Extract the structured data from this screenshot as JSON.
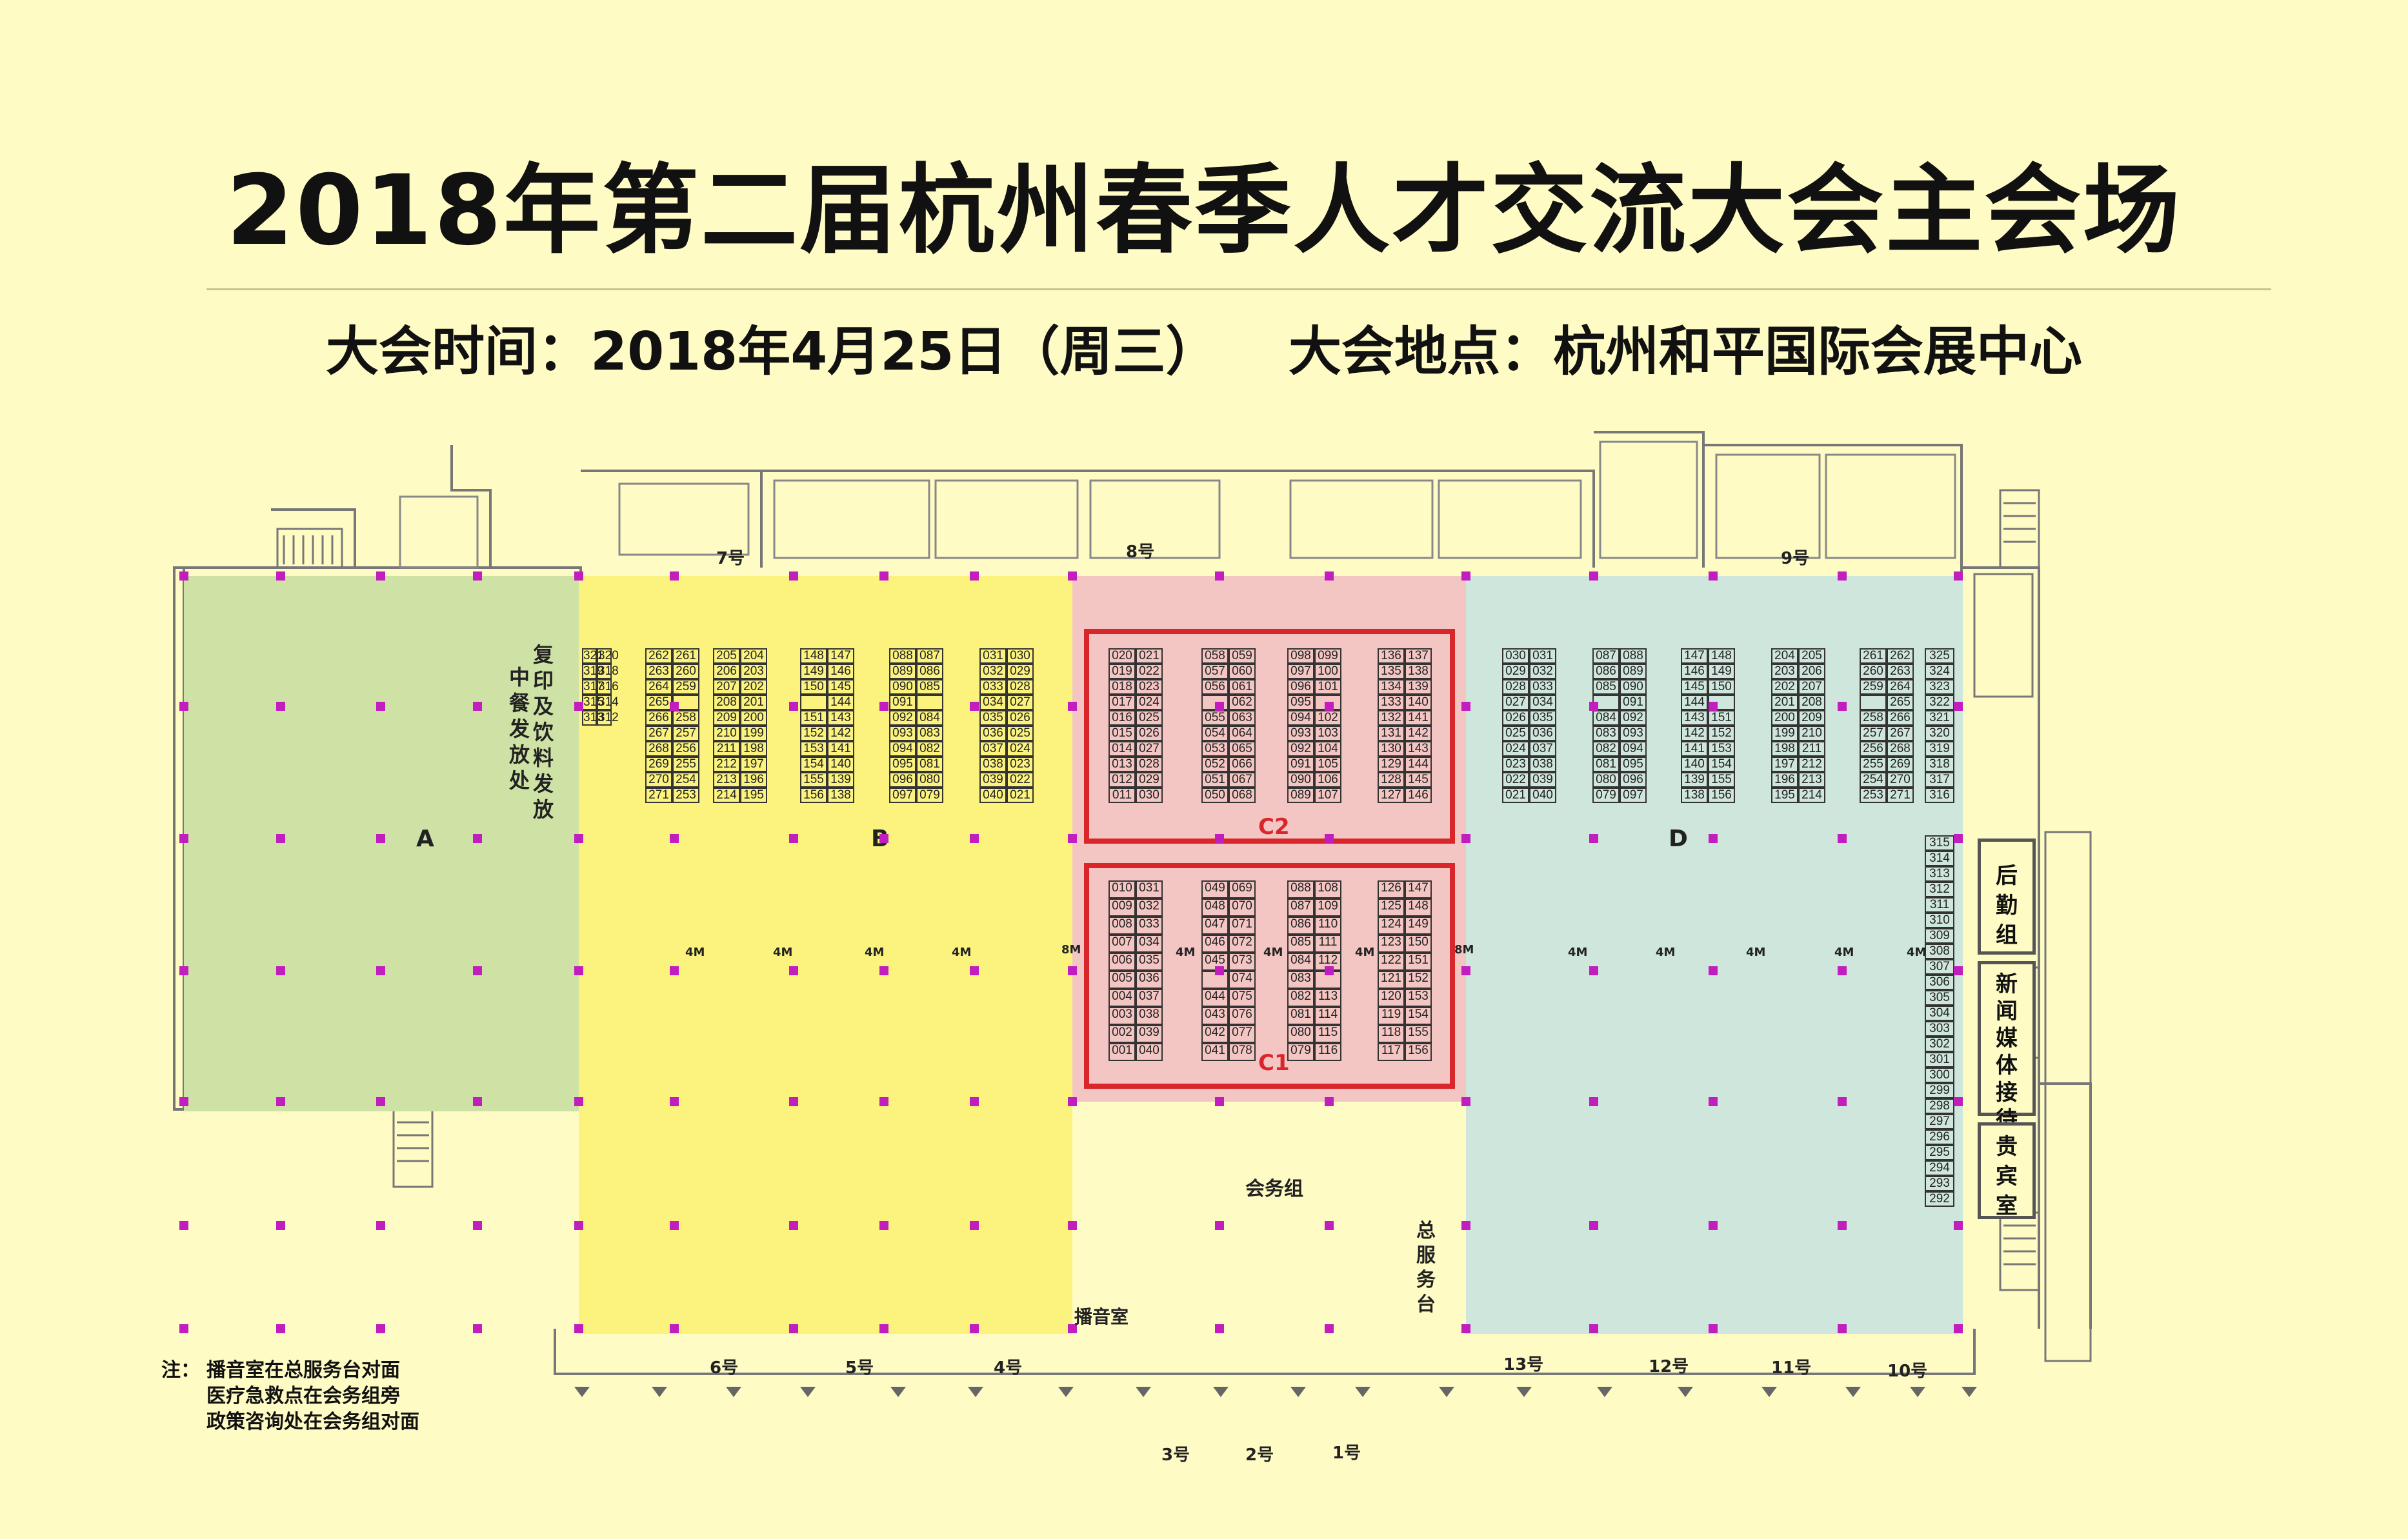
{
  "title": "2018年第二届杭州春季人才交流大会主会场",
  "subtitle": {
    "time": "大会时间：2018年4月25日（周三）",
    "venue": "大会地点：杭州和平国际会展中心"
  },
  "zones": {
    "A": "A",
    "B": "B",
    "D": "D",
    "C1": "C1",
    "C2": "C2"
  },
  "areas": {
    "copy_drink": "复印及饮料发放",
    "meal": "中餐发放处",
    "affairs_group": "会务组",
    "service_desk": "总服务台",
    "broadcast": "播音室",
    "logistics": "后勤组",
    "media": "新闻媒体接待",
    "vip": "贵宾室"
  },
  "entrances": {
    "e1": "1号",
    "e2": "2号",
    "e3": "3号",
    "e4": "4号",
    "e5": "5号",
    "e6": "6号",
    "e7": "7号",
    "e8": "8号",
    "e9": "9号",
    "e10": "10号",
    "e11": "11号",
    "e12": "12号",
    "e13": "13号"
  },
  "aisles": {
    "small": "4M",
    "large": "8M"
  },
  "notes": {
    "label": "注：",
    "line1": "播音室在总服务台对面",
    "line2": "医疗急救点在会务组旁",
    "line3": "政策咨询处在会务组对面"
  },
  "colors": {
    "background": "#FFFBC4",
    "zoneA": "#CFE2A6",
    "zoneB": "#FBF37E",
    "zoneC": "#F4C6C3",
    "zoneD": "#CFE6DC",
    "highlight": "#D9262B",
    "column": "#C21DBE"
  },
  "booths": {
    "B": [
      {
        "rows": [
          [
            "321",
            "320"
          ],
          [
            "319",
            "318"
          ],
          [
            "317",
            "316"
          ],
          [
            "315",
            "314"
          ],
          [
            "313",
            "312"
          ]
        ]
      },
      {
        "rows": [
          [
            "262",
            "261"
          ],
          [
            "263",
            "260"
          ],
          [
            "264",
            "259"
          ],
          [
            "265",
            ""
          ],
          [
            "266",
            "258"
          ],
          [
            "267",
            "257"
          ],
          [
            "268",
            "256"
          ],
          [
            "269",
            "255"
          ],
          [
            "270",
            "254"
          ],
          [
            "271",
            "253"
          ]
        ]
      },
      {
        "rows": [
          [
            "205",
            "204"
          ],
          [
            "206",
            "203"
          ],
          [
            "207",
            "202"
          ],
          [
            "208",
            "201"
          ],
          [
            "209",
            "200"
          ],
          [
            "210",
            "199"
          ],
          [
            "211",
            "198"
          ],
          [
            "212",
            "197"
          ],
          [
            "213",
            "196"
          ],
          [
            "214",
            "195"
          ]
        ]
      },
      {
        "rows": [
          [
            "148",
            "147"
          ],
          [
            "149",
            "146"
          ],
          [
            "150",
            "145"
          ],
          [
            "",
            "144"
          ],
          [
            "151",
            "143"
          ],
          [
            "152",
            "142"
          ],
          [
            "153",
            "141"
          ],
          [
            "154",
            "140"
          ],
          [
            "155",
            "139"
          ],
          [
            "156",
            "138"
          ]
        ]
      },
      {
        "rows": [
          [
            "088",
            "087"
          ],
          [
            "089",
            "086"
          ],
          [
            "090",
            "085"
          ],
          [
            "091",
            ""
          ],
          [
            "092",
            "084"
          ],
          [
            "093",
            "083"
          ],
          [
            "094",
            "082"
          ],
          [
            "095",
            "081"
          ],
          [
            "096",
            "080"
          ],
          [
            "097",
            "079"
          ]
        ]
      },
      {
        "rows": [
          [
            "031",
            "030"
          ],
          [
            "032",
            "029"
          ],
          [
            "033",
            "028"
          ],
          [
            "034",
            "027"
          ],
          [
            "035",
            "026"
          ],
          [
            "036",
            "025"
          ],
          [
            "037",
            "024"
          ],
          [
            "038",
            "023"
          ],
          [
            "039",
            "022"
          ],
          [
            "040",
            "021"
          ]
        ]
      }
    ],
    "C2": [
      {
        "rows": [
          [
            "020",
            "021"
          ],
          [
            "019",
            "022"
          ],
          [
            "018",
            "023"
          ],
          [
            "017",
            "024"
          ],
          [
            "016",
            "025"
          ],
          [
            "015",
            "026"
          ],
          [
            "014",
            "027"
          ],
          [
            "013",
            "028"
          ],
          [
            "012",
            "029"
          ],
          [
            "011",
            "030"
          ]
        ]
      },
      {
        "rows": [
          [
            "058",
            "059"
          ],
          [
            "057",
            "060"
          ],
          [
            "056",
            "061"
          ],
          [
            "",
            "062"
          ],
          [
            "055",
            "063"
          ],
          [
            "054",
            "064"
          ],
          [
            "053",
            "065"
          ],
          [
            "052",
            "066"
          ],
          [
            "051",
            "067"
          ],
          [
            "050",
            "068"
          ]
        ]
      },
      {
        "rows": [
          [
            "098",
            "099"
          ],
          [
            "097",
            "100"
          ],
          [
            "096",
            "101"
          ],
          [
            "095",
            ""
          ],
          [
            "094",
            "102"
          ],
          [
            "093",
            "103"
          ],
          [
            "092",
            "104"
          ],
          [
            "091",
            "105"
          ],
          [
            "090",
            "106"
          ],
          [
            "089",
            "107"
          ]
        ]
      },
      {
        "rows": [
          [
            "136",
            "137"
          ],
          [
            "135",
            "138"
          ],
          [
            "134",
            "139"
          ],
          [
            "133",
            "140"
          ],
          [
            "132",
            "141"
          ],
          [
            "131",
            "142"
          ],
          [
            "130",
            "143"
          ],
          [
            "129",
            "144"
          ],
          [
            "128",
            "145"
          ],
          [
            "127",
            "146"
          ]
        ]
      }
    ],
    "C1": [
      {
        "rows": [
          [
            "010",
            "031"
          ],
          [
            "009",
            "032"
          ],
          [
            "008",
            "033"
          ],
          [
            "007",
            "034"
          ],
          [
            "006",
            "035"
          ],
          [
            "005",
            "036"
          ],
          [
            "004",
            "037"
          ],
          [
            "003",
            "038"
          ],
          [
            "002",
            "039"
          ],
          [
            "001",
            "040"
          ]
        ]
      },
      {
        "rows": [
          [
            "049",
            "069"
          ],
          [
            "048",
            "070"
          ],
          [
            "047",
            "071"
          ],
          [
            "046",
            "072"
          ],
          [
            "045",
            "073"
          ],
          [
            "",
            "074"
          ],
          [
            "044",
            "075"
          ],
          [
            "043",
            "076"
          ],
          [
            "042",
            "077"
          ],
          [
            "041",
            "078"
          ]
        ]
      },
      {
        "rows": [
          [
            "088",
            "108"
          ],
          [
            "087",
            "109"
          ],
          [
            "086",
            "110"
          ],
          [
            "085",
            "111"
          ],
          [
            "084",
            "112"
          ],
          [
            "083",
            ""
          ],
          [
            "082",
            "113"
          ],
          [
            "081",
            "114"
          ],
          [
            "080",
            "115"
          ],
          [
            "079",
            "116"
          ]
        ]
      },
      {
        "rows": [
          [
            "126",
            "147"
          ],
          [
            "125",
            "148"
          ],
          [
            "124",
            "149"
          ],
          [
            "123",
            "150"
          ],
          [
            "122",
            "151"
          ],
          [
            "121",
            "152"
          ],
          [
            "120",
            "153"
          ],
          [
            "119",
            "154"
          ],
          [
            "118",
            "155"
          ],
          [
            "117",
            "156"
          ]
        ]
      }
    ],
    "D": [
      {
        "rows": [
          [
            "030",
            "031"
          ],
          [
            "029",
            "032"
          ],
          [
            "028",
            "033"
          ],
          [
            "027",
            "034"
          ],
          [
            "026",
            "035"
          ],
          [
            "025",
            "036"
          ],
          [
            "024",
            "037"
          ],
          [
            "023",
            "038"
          ],
          [
            "022",
            "039"
          ],
          [
            "021",
            "040"
          ]
        ]
      },
      {
        "rows": [
          [
            "087",
            "088"
          ],
          [
            "086",
            "089"
          ],
          [
            "085",
            "090"
          ],
          [
            "",
            "091"
          ],
          [
            "084",
            "092"
          ],
          [
            "083",
            "093"
          ],
          [
            "082",
            "094"
          ],
          [
            "081",
            "095"
          ],
          [
            "080",
            "096"
          ],
          [
            "079",
            "097"
          ]
        ]
      },
      {
        "rows": [
          [
            "147",
            "148"
          ],
          [
            "146",
            "149"
          ],
          [
            "145",
            "150"
          ],
          [
            "144",
            ""
          ],
          [
            "143",
            "151"
          ],
          [
            "142",
            "152"
          ],
          [
            "141",
            "153"
          ],
          [
            "140",
            "154"
          ],
          [
            "139",
            "155"
          ],
          [
            "138",
            "156"
          ]
        ]
      },
      {
        "rows": [
          [
            "204",
            "205"
          ],
          [
            "203",
            "206"
          ],
          [
            "202",
            "207"
          ],
          [
            "201",
            "208"
          ],
          [
            "200",
            "209"
          ],
          [
            "199",
            "210"
          ],
          [
            "198",
            "211"
          ],
          [
            "197",
            "212"
          ],
          [
            "196",
            "213"
          ],
          [
            "195",
            "214"
          ]
        ]
      },
      {
        "rows": [
          [
            "261",
            "262"
          ],
          [
            "260",
            "263"
          ],
          [
            "259",
            "264"
          ],
          [
            "",
            "265"
          ],
          [
            "258",
            "266"
          ],
          [
            "257",
            "267"
          ],
          [
            "256",
            "268"
          ],
          [
            "255",
            "269"
          ],
          [
            "254",
            "270"
          ],
          [
            "253",
            "271"
          ]
        ]
      },
      {
        "rows": [
          [
            "325"
          ],
          [
            "324"
          ],
          [
            "323"
          ],
          [
            "322"
          ],
          [
            "321"
          ],
          [
            "320"
          ],
          [
            "319"
          ],
          [
            "318"
          ],
          [
            "317"
          ],
          [
            "316"
          ]
        ]
      }
    ],
    "rightColumn": [
      [
        "315"
      ],
      [
        "314"
      ],
      [
        "313"
      ],
      [
        "312"
      ],
      [
        "311"
      ],
      [
        "310"
      ],
      [
        "309"
      ],
      [
        "308"
      ],
      [
        "307"
      ],
      [
        "306"
      ],
      [
        "305"
      ],
      [
        "304"
      ],
      [
        "303"
      ],
      [
        "302"
      ],
      [
        "301"
      ],
      [
        "300"
      ],
      [
        "299"
      ],
      [
        "298"
      ],
      [
        "297"
      ],
      [
        "296"
      ],
      [
        "295"
      ],
      [
        "294"
      ],
      [
        "293"
      ],
      [
        "292"
      ]
    ]
  }
}
